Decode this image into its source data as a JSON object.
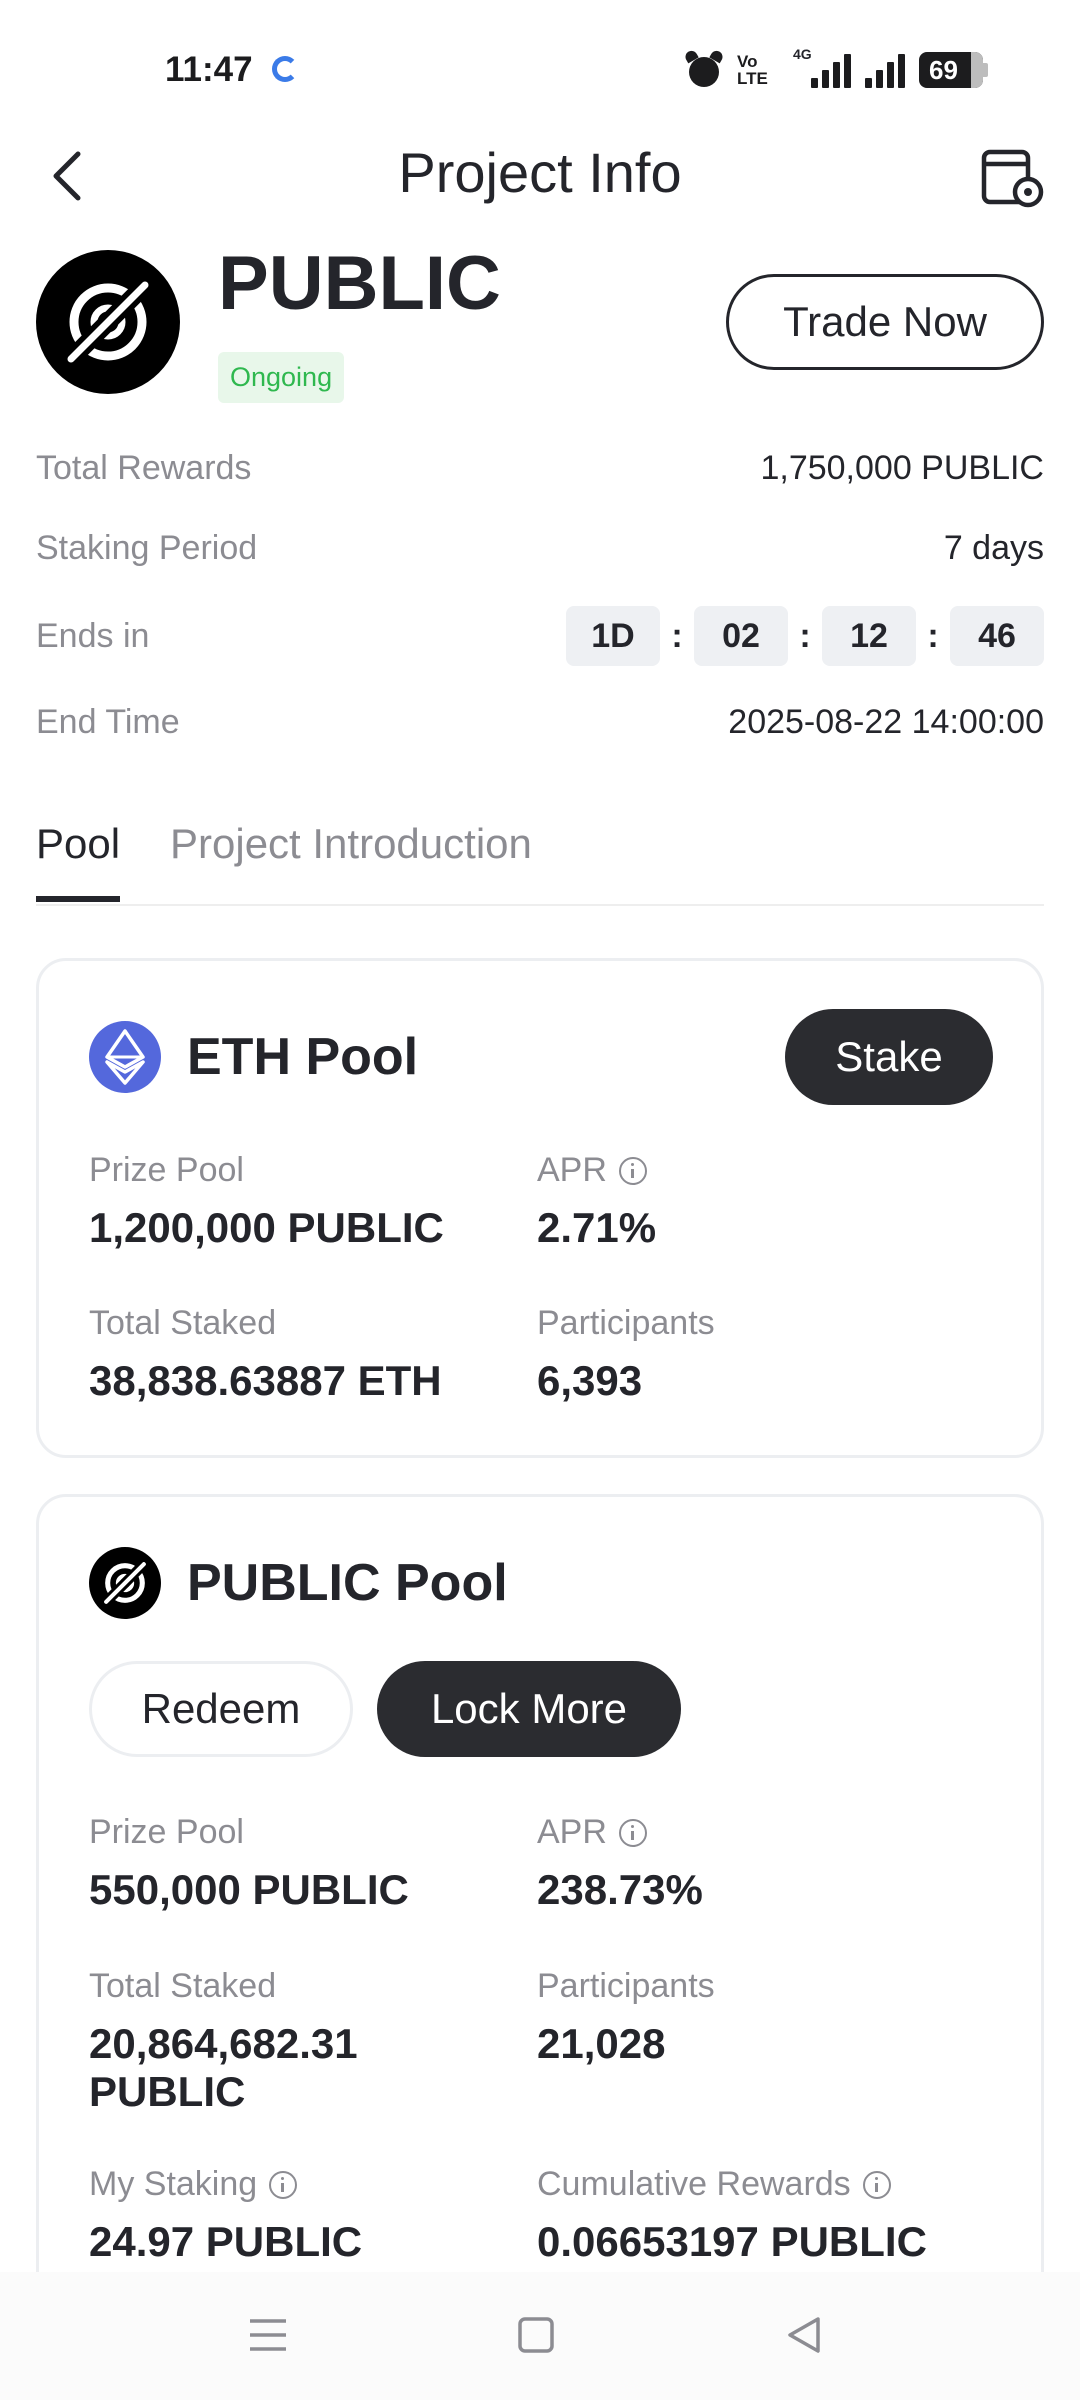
{
  "status_bar": {
    "time": "11:47",
    "network_label": "Vo LTE",
    "signal_label": "4G",
    "battery": "69"
  },
  "header": {
    "title": "Project Info",
    "back_icon": "chevron-left-icon",
    "settings_icon": "settings-calendar-icon"
  },
  "project": {
    "name": "PUBLIC",
    "status": "Ongoing",
    "trade_button": "Trade Now"
  },
  "info": {
    "total_rewards_label": "Total Rewards",
    "total_rewards_value": "1,750,000 PUBLIC",
    "staking_period_label": "Staking Period",
    "staking_period_value": "7 days",
    "ends_in_label": "Ends in",
    "countdown": {
      "days": "1D",
      "hours": "02",
      "minutes": "12",
      "seconds": "46",
      "separator": ":"
    },
    "end_time_label": "End Time",
    "end_time_value": "2025-08-22 14:00:00"
  },
  "tabs": [
    {
      "label": "Pool",
      "active": true
    },
    {
      "label": "Project Introduction",
      "active": false
    }
  ],
  "pools": [
    {
      "name": "ETH Pool",
      "action": "Stake",
      "stats": {
        "prize_pool_label": "Prize Pool",
        "prize_pool_value": "1,200,000 PUBLIC",
        "apr_label": "APR",
        "apr_value": "2.71%",
        "total_staked_label": "Total Staked",
        "total_staked_value": "38,838.63887 ETH",
        "participants_label": "Participants",
        "participants_value": "6,393"
      }
    },
    {
      "name": "PUBLIC Pool",
      "redeem": "Redeem",
      "lock_more": "Lock More",
      "stats": {
        "prize_pool_label": "Prize Pool",
        "prize_pool_value": "550,000 PUBLIC",
        "apr_label": "APR",
        "apr_value": "238.73%",
        "total_staked_label": "Total Staked",
        "total_staked_value": "20,864,682.31 PUBLIC",
        "participants_label": "Participants",
        "participants_value": "21,028",
        "my_staking_label": "My Staking",
        "my_staking_value": "24.97 PUBLIC",
        "cumulative_rewards_label": "Cumulative Rewards",
        "cumulative_rewards_value": "0.06653197 PUBLIC"
      }
    }
  ],
  "colors": {
    "status_ongoing": "#2fb84f",
    "eth_icon": "#5468dc",
    "dark_button": "#2b2c30"
  }
}
